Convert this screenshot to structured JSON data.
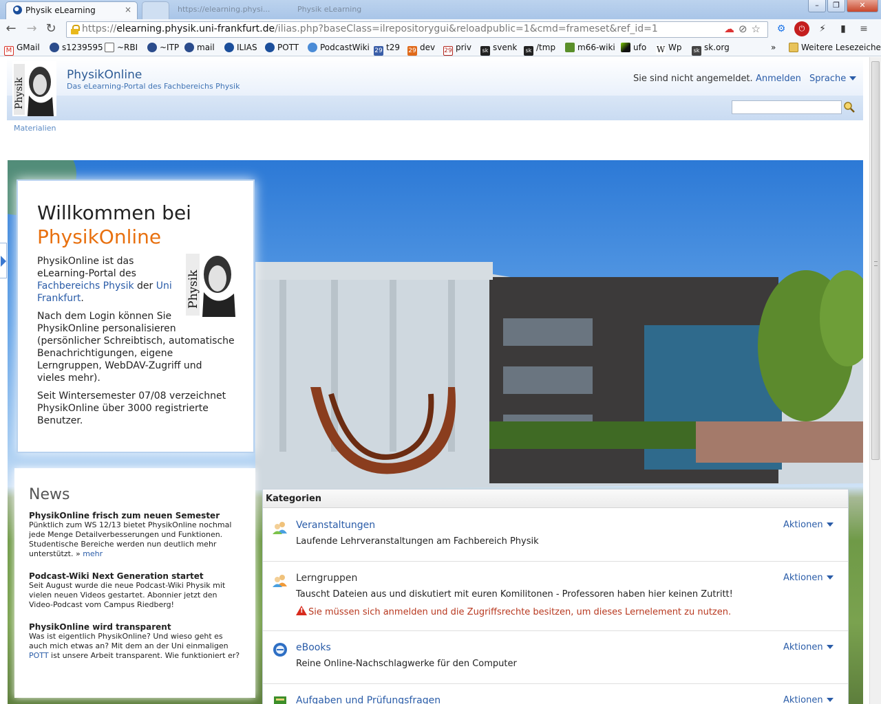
{
  "browser": {
    "tab_title": "Physik eLearning",
    "tab_close": "×",
    "ghost_tab_1": "https://elearning.physi...",
    "ghost_tab_2": "Physik eLearning",
    "window_buttons": [
      "–",
      "❐",
      "✕"
    ],
    "url_scheme": "https://",
    "url_domain": "elearning.physik.uni-frankfurt.de",
    "url_rest": "/ilias.php?baseClass=ilrepositorygui&reloadpublic=1&cmd=frameset&ref_id=1",
    "nav_back": "←",
    "nav_forward": "→",
    "nav_reload": "↻",
    "bookmarks": [
      {
        "label": "GMail",
        "icon": "gmail-icon",
        "color": "#d93025"
      },
      {
        "label": "s1239595",
        "icon": "user-icon",
        "color": "#2b4c8c"
      },
      {
        "label": "~RBI",
        "icon": "page-icon",
        "color": "#ffffff"
      },
      {
        "label": "~ITP",
        "icon": "user-icon",
        "color": "#2b4c8c"
      },
      {
        "label": "mail",
        "icon": "user-icon",
        "color": "#2b4c8c"
      },
      {
        "label": "ILIAS",
        "icon": "ilias-icon",
        "color": "#1b4e9b"
      },
      {
        "label": "POTT",
        "icon": "ilias-icon",
        "color": "#1b4e9b"
      },
      {
        "label": "PodcastWiki",
        "icon": "podcast-icon",
        "color": "#4a8bd6"
      },
      {
        "label": "t29",
        "icon": "calendar-icon",
        "color": "#3a5ea8"
      },
      {
        "label": "dev",
        "icon": "calendar-icon",
        "color": "#e06a1b"
      },
      {
        "label": "priv",
        "icon": "calendar-icon",
        "color": "#b3261e"
      },
      {
        "label": "svenk",
        "icon": "sk-icon",
        "color": "#222222"
      },
      {
        "label": "/tmp",
        "icon": "sk-icon",
        "color": "#222222"
      },
      {
        "label": "m66-wiki",
        "icon": "wiki-icon",
        "color": "#5a8f2a"
      },
      {
        "label": "ufo",
        "icon": "ufo-icon",
        "color": "#111111"
      },
      {
        "label": "Wp",
        "icon": "wikipedia-icon",
        "color": "#ffffff"
      },
      {
        "label": "sk.org",
        "icon": "sk-icon",
        "color": "#444444"
      }
    ],
    "bookmarks_more": "»",
    "other_bookmarks": "Weitere Lesezeichen"
  },
  "header": {
    "site_title": "PhysikOnline",
    "site_subtitle": "Das eLearning-Portal des Fachbereichs Physik",
    "login_status": "Sie sind nicht angemeldet.",
    "login_link": "Anmelden",
    "language_link": "Sprache",
    "search_placeholder": ""
  },
  "breadcrumb": "Materialien",
  "welcome": {
    "heading": "Willkommen bei",
    "brand": "PhysikOnline",
    "p1_a": "PhysikOnline ist das",
    "p1_b": "eLearning-Portal des",
    "p1_link1": "Fachbereichs Physik",
    "p1_c": " der ",
    "p1_link2_a": "Uni",
    "p1_link2_b": "Frankfurt",
    "p1_end": ".",
    "p2": [
      "Nach dem Login können Sie",
      "PhysikOnline personalisieren",
      "(persönlicher Schreibtisch, automatische",
      "Benachrichtigungen, eigene",
      "Lerngruppen, WebDAV-Zugriff und",
      "vieles mehr)."
    ],
    "p3": [
      "Seit Wintersemester 07/08 verzeichnet",
      "PhysikOnline über 3000 registrierte",
      "Benutzer."
    ]
  },
  "news": {
    "heading": "News",
    "items": [
      {
        "title": "PhysikOnline frisch zum neuen Semester",
        "text": "Pünktlich zum WS 12/13 bietet PhysikOnline nochmal jede Menge Detailverbesserungen und Funktionen. Studentische Bereiche werden nun deutlich mehr unterstützt. » ",
        "link": "mehr"
      },
      {
        "title": "Podcast-Wiki Next Generation startet",
        "text": "Seit August wurde die neue Podcast-Wiki Physik mit vielen neuen Videos gestartet. Abonnier jetzt den Video-Podcast vom Campus Riedberg!"
      },
      {
        "title": "PhysikOnline wird transparent",
        "text_a": "Was ist eigentlich PhysikOnline? Und wieso geht es auch mich etwas an? Mit dem an der Uni einmaligen ",
        "link": "POTT",
        "text_b": " ist unsere Arbeit transparent. Wie funktioniert er?"
      }
    ]
  },
  "categories": {
    "heading": "Kategorien",
    "actions_label": "Aktionen",
    "items": [
      {
        "title": "Veranstaltungen",
        "desc": "Laufende Lehrveranstaltungen am Fachbereich Physik",
        "icon": "group-icon"
      },
      {
        "title": "Lerngruppen",
        "desc": "Tauscht Dateien aus und diskutiert mit euren Komilitonen - Professoren haben hier keinen Zutritt!",
        "warning": "Sie müssen sich anmelden und die Zugriffsrechte besitzen, um dieses Lernelement zu nutzen.",
        "icon": "group-icon"
      },
      {
        "title": "eBooks",
        "desc": "Reine Online-Nachschlagwerke für den Computer",
        "icon": "ebook-icon"
      },
      {
        "title": "Aufgaben und Prüfungsfragen",
        "desc": "",
        "icon": "exercise-icon"
      }
    ]
  }
}
